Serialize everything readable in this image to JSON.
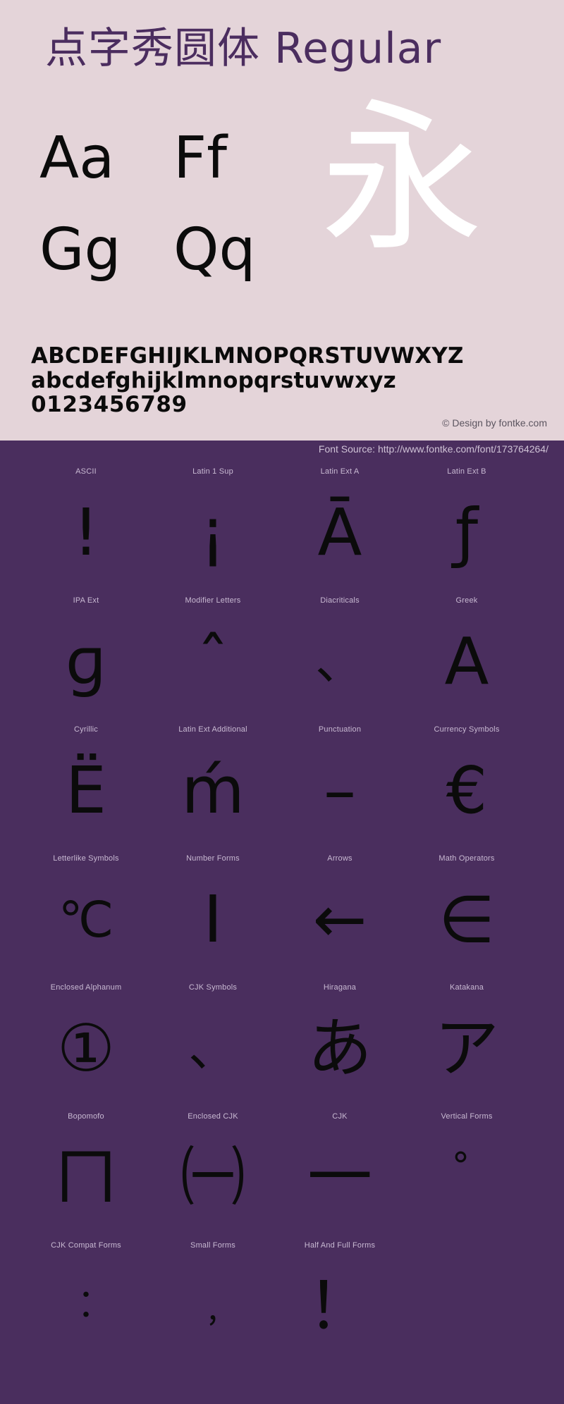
{
  "colors": {
    "header_bg": "#e4d4d9",
    "panel_bg": "#4a2e5e",
    "title_fg": "#4b2d5f",
    "glyph_fg": "#0b0b0b",
    "accent_white": "#ffffff",
    "label_fg": "#c8b9d2",
    "copyright_fg": "#5c5560",
    "source_fg": "#cfc2d6"
  },
  "header": {
    "title": "点字秀圆体  Regular",
    "letter_pairs": [
      [
        "Aa",
        "Ff"
      ],
      [
        "Gg",
        "Qq"
      ]
    ],
    "showcase_glyph": "永",
    "alphabet_upper": "ABCDEFGHIJKLMNOPQRSTUVWXYZ",
    "alphabet_lower": "abcdefghijklmnopqrstuvwxyz",
    "digits": "0123456789",
    "copyright": "© Design by fontke.com"
  },
  "source": {
    "label": "Font Source: http://www.fontke.com/font/173764264/"
  },
  "unicode_blocks": {
    "rows": [
      [
        {
          "label": "ASCII",
          "glyph": "!",
          "size": ""
        },
        {
          "label": "Latin 1 Sup",
          "glyph": "¡",
          "size": ""
        },
        {
          "label": "Latin Ext A",
          "glyph": "Ā",
          "size": ""
        },
        {
          "label": "Latin Ext B",
          "glyph": "ƒ",
          "size": ""
        }
      ],
      [
        {
          "label": "IPA Ext",
          "glyph": "ɡ",
          "size": ""
        },
        {
          "label": "Modifier Letters",
          "glyph": "ˆ",
          "size": ""
        },
        {
          "label": "Diacriticals",
          "glyph": "、",
          "size": "small"
        },
        {
          "label": "Greek",
          "glyph": "Α",
          "size": ""
        }
      ],
      [
        {
          "label": "Cyrillic",
          "glyph": "Ё",
          "size": ""
        },
        {
          "label": "Latin Ext Additional",
          "glyph": "ḿ",
          "size": ""
        },
        {
          "label": "Punctuation",
          "glyph": "–",
          "size": ""
        },
        {
          "label": "Currency Symbols",
          "glyph": "€",
          "size": ""
        }
      ],
      [
        {
          "label": "Letterlike Symbols",
          "glyph": "℃",
          "size": "small"
        },
        {
          "label": "Number Forms",
          "glyph": "Ⅰ",
          "size": ""
        },
        {
          "label": "Arrows",
          "glyph": "←",
          "size": ""
        },
        {
          "label": "Math Operators",
          "glyph": "∈",
          "size": ""
        }
      ],
      [
        {
          "label": "Enclosed Alphanum",
          "glyph": "①",
          "size": ""
        },
        {
          "label": "CJK Symbols",
          "glyph": "、",
          "size": "small"
        },
        {
          "label": "Hiragana",
          "glyph": "あ",
          "size": ""
        },
        {
          "label": "Katakana",
          "glyph": "ア",
          "size": ""
        }
      ],
      [
        {
          "label": "Bopomofo",
          "glyph": "ㄇ",
          "size": ""
        },
        {
          "label": "Enclosed CJK",
          "glyph": "㈠",
          "size": ""
        },
        {
          "label": "CJK",
          "glyph": "一",
          "size": ""
        },
        {
          "label": "Vertical Forms",
          "glyph": "゚",
          "size": "small"
        }
      ],
      [
        {
          "label": "CJK Compat Forms",
          "glyph": "︰",
          "size": "tiny"
        },
        {
          "label": "Small Forms",
          "glyph": "﹐",
          "size": "tiny"
        },
        {
          "label": "Half And Full Forms",
          "glyph": "！",
          "size": ""
        },
        {
          "label": "",
          "glyph": "",
          "size": ""
        }
      ]
    ]
  }
}
